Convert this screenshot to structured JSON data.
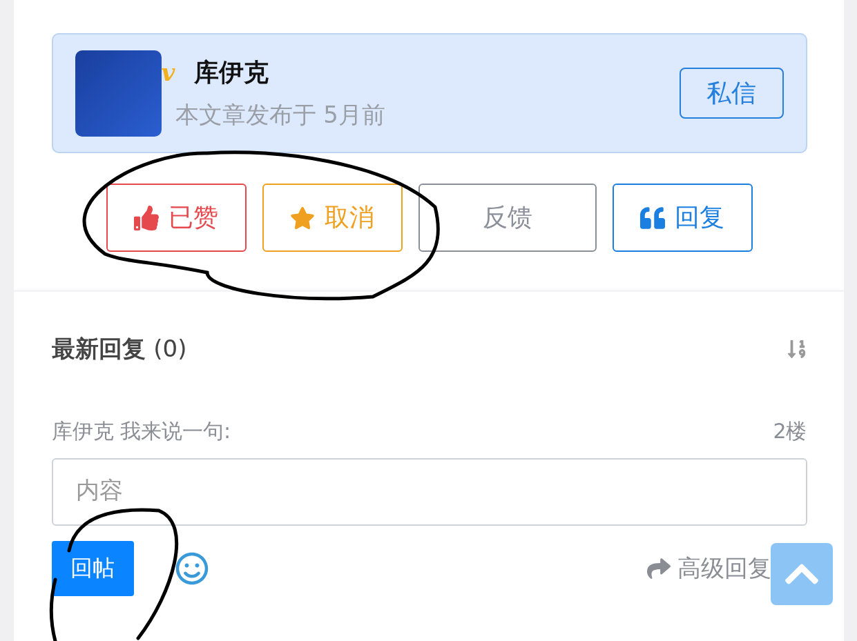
{
  "author": {
    "name": "库伊克",
    "badge": "v",
    "meta": "本文章发布于 5月前",
    "message_button": "私信"
  },
  "actions": [
    {
      "kind": "like",
      "label": "已赞",
      "color": "#e5484d"
    },
    {
      "kind": "favorite",
      "label": "取消",
      "color": "#f0a020"
    },
    {
      "kind": "plain",
      "label": "反馈",
      "color": "#8a8f99"
    },
    {
      "kind": "quote",
      "label": "回复",
      "color": "#1a7fe0"
    }
  ],
  "replies": {
    "title": "最新回复",
    "count": "(0)"
  },
  "comment_form": {
    "prompt": "库伊克 我来说一句:",
    "floor": "2楼",
    "placeholder": "内容",
    "submit": "回帖",
    "advanced": "高级回复"
  }
}
